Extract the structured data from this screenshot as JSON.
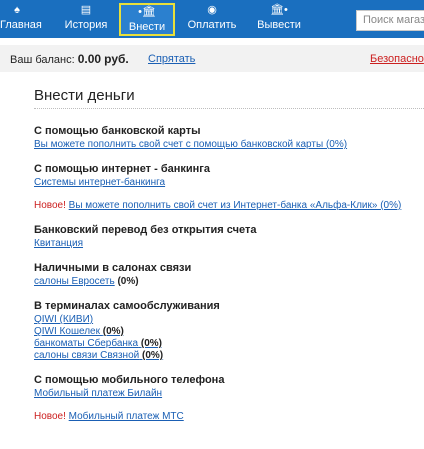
{
  "nav": {
    "items": [
      {
        "label": "Главная",
        "icon": "home-icon",
        "glyph": "♠"
      },
      {
        "label": "История",
        "icon": "history-icon",
        "glyph": "▤"
      },
      {
        "label": "Внести",
        "icon": "deposit-icon",
        "glyph": "•🏛"
      },
      {
        "label": "Оплатить",
        "icon": "pay-icon",
        "glyph": "◉"
      },
      {
        "label": "Вывести",
        "icon": "withdraw-icon",
        "glyph": "🏛•"
      }
    ],
    "search_placeholder": "Поиск магаз",
    "accent": "#1a6fbf",
    "active_border": "#e8df3a"
  },
  "balance": {
    "label": "Ваш баланс: ",
    "amount": "0.00",
    "currency": "руб.",
    "hide": "Спрятать",
    "safe": "Безопасно"
  },
  "page": {
    "title": "Внести деньги"
  },
  "sections": {
    "card": {
      "title": "С помощью банковской карты",
      "link": "Вы можете пополнить свой счет с помощью банковской карты (0%)"
    },
    "ibank": {
      "title": "С помощью интернет - банкинга",
      "link": "Системы интернет-банкинга"
    },
    "alfa": {
      "new": "Новое!",
      "link": "Вы можете пополнить свой счет из Интернет-банка «Альфа-Клик» (0%)"
    },
    "transfer": {
      "title": "Банковский перевод без открытия счета",
      "link": "Квитанция"
    },
    "cash": {
      "title": "Наличными в салонах связи",
      "link": "салоны Евросеть",
      "pct": "(0%)"
    },
    "terminals": {
      "title": "В терминалах самообслуживания",
      "qiwi": "QIWI (КИВИ)",
      "wallet": "QIWI Кошелек",
      "wallet_pct": "(0%)",
      "sber": "банкоматы Сбербанка",
      "sber_pct": "(0%)",
      "svyaznoy": "салоны связи Связной",
      "svyaznoy_pct": "(0%)"
    },
    "mobile": {
      "title": "С помощью мобильного телефона",
      "beeline": "Мобильный платеж Билайн"
    },
    "mts": {
      "new": "Новое!",
      "link": "Мобильный платеж МТС"
    }
  }
}
